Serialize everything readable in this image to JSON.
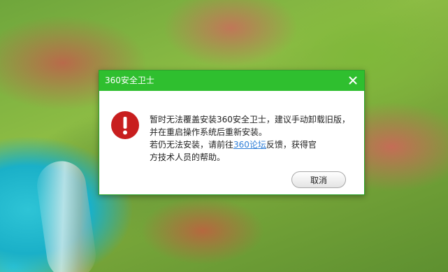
{
  "dialog": {
    "title": "360安全卫士",
    "message_line1": "暂时无法覆盖安装360安全卫士，建议手动卸载旧版，",
    "message_line2": "并在重启操作系统后重新安装。",
    "message_line3_prefix": "若仍无法安装，请前往",
    "forum_link": "360论坛",
    "message_line3_suffix": "反馈，获得官",
    "message_line4": "方技术人员的帮助。",
    "cancel_label": "取消",
    "icons": {
      "close": "close-icon",
      "error": "error-icon"
    }
  },
  "colors": {
    "titlebar": "#2fbf2f",
    "error_icon": "#c81e1e",
    "link": "#2f7fd8"
  }
}
